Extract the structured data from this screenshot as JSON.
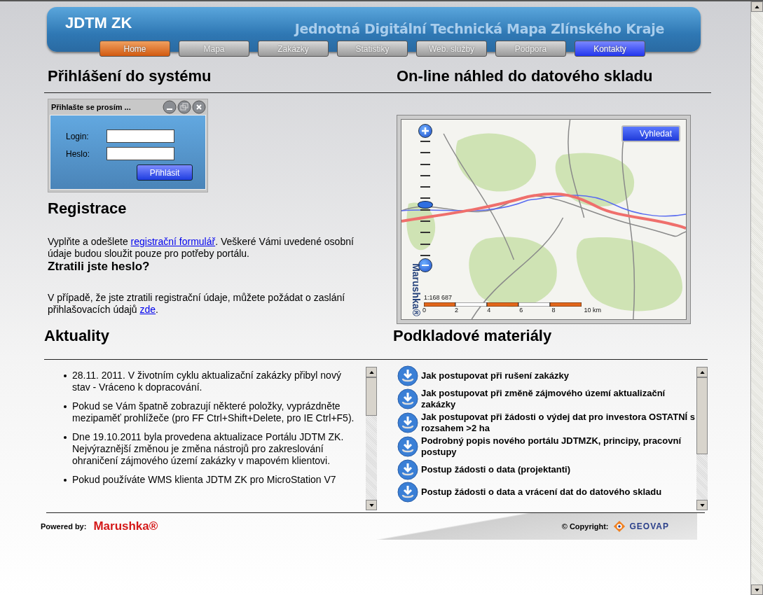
{
  "header": {
    "title": "JDTM ZK",
    "subtitle": "Jednotná Digitální Technická Mapa Zlínského Kraje"
  },
  "nav": [
    {
      "label": "Home",
      "selected": true,
      "kind": "normal"
    },
    {
      "label": "Mapa",
      "selected": false,
      "kind": "normal"
    },
    {
      "label": "Zakázky",
      "selected": false,
      "kind": "normal"
    },
    {
      "label": "Statistiky",
      "selected": false,
      "kind": "normal"
    },
    {
      "label": "Web. služby",
      "selected": false,
      "kind": "normal"
    },
    {
      "label": "Podpora",
      "selected": false,
      "kind": "normal"
    },
    {
      "label": "Kontakty",
      "selected": false,
      "kind": "highlight"
    }
  ],
  "login": {
    "heading": "Přihlášení do systému",
    "window_title": "Přihlašte se prosím ...",
    "login_label": "Login:",
    "password_label": "Heslo:",
    "submit": "Přihlásit"
  },
  "registration": {
    "heading": "Registrace",
    "text_before": "Vyplňte a odešlete ",
    "link": "registrační formulář",
    "text_after": ". Veškeré Vámi uvedené osobní údaje budou sloužit pouze pro potřeby portálu."
  },
  "lost_password": {
    "heading": "Ztratili jste heslo?",
    "text_before": "V případě, že jste ztratili registrační údaje, můžete požádat o zaslání přihlašovacích údajů ",
    "link": "zde",
    "text_after": "."
  },
  "map": {
    "heading": "On-line náhled do datového skladu",
    "search_button": "Vyhledat",
    "brand": "Marushka®",
    "zoom": {
      "level": 0.45
    },
    "scale": "1:168 687",
    "scale_labels": [
      "0",
      "2",
      "4",
      "6",
      "8",
      "10 km"
    ]
  },
  "news": {
    "heading": "Aktuality",
    "items": [
      "28.11. 2011. V životním cyklu aktualizační zakázky přibyl nový stav - Vráceno k dopracování.",
      "Pokud se Vám špatně zobrazují některé položky, vyprázdněte mezipaměť prohlížeče (pro FF Ctrl+Shift+Delete, pro IE Ctrl+F5).",
      "Dne 19.10.2011 byla provedena aktualizace Portálu JDTM ZK. Nejvýraznější změnou je změna nástrojů pro zakreslování ohraničení zájmového území zakázky v mapovém klientovi.",
      "Pokud používáte WMS klienta JDTM ZK pro MicroStation V7"
    ]
  },
  "materials": {
    "heading": "Podkladové materiály",
    "items": [
      "Jak postupovat při rušení zakázky",
      "Jak postupovat při změně zájmového území aktualizační zakázky",
      "Jak postupovat při žádosti o výdej dat pro investora OSTATNÍ s rozsahem >2 ha",
      "Podrobný popis nového portálu JDTMZK, principy, pracovní postupy",
      "Postup žádosti o data (projektanti)",
      "Postup žádosti o data a vrácení dat do datového skladu"
    ]
  },
  "footer": {
    "powered_label": "Powered by:",
    "powered_brand": "Marushka®",
    "copyright_label": "© Copyright:",
    "copyright_brand": "GEOVAP"
  }
}
